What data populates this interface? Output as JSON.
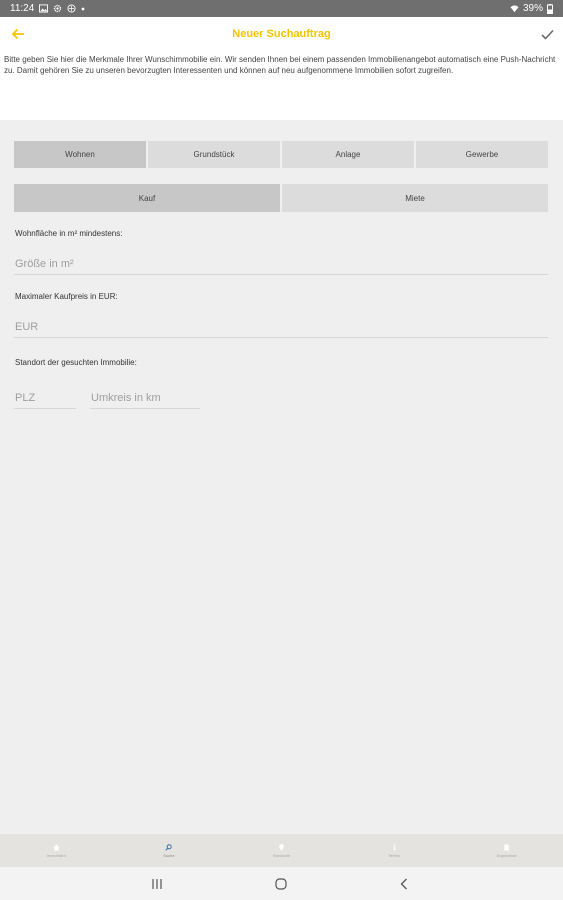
{
  "status_bar": {
    "time": "11:24",
    "battery": "39%",
    "icons": [
      "image-icon",
      "settings-icon",
      "vpn-icon",
      "dot-icon",
      "wifi-icon",
      "battery-icon"
    ]
  },
  "app_bar": {
    "title": "Neuer Suchauftrag",
    "back_icon": "arrow-left-icon",
    "confirm_icon": "check-icon",
    "accent_color": "#f5c400"
  },
  "intro_text": "Bitte geben Sie hier die Merkmale Ihrer Wunschimmobilie ein. Wir senden Ihnen bei einem passenden Immobilienangebot automatisch eine Push-Nachricht zu. Damit gehören Sie zu unseren bevorzugten Interessenten und können auf neu aufgenommene Immobilien sofort zugreifen.",
  "property_types": {
    "selected": "Wohnen",
    "options": [
      "Wohnen",
      "Grundstück",
      "Anlage",
      "Gewerbe"
    ]
  },
  "transaction_types": {
    "selected": "Kauf",
    "options": [
      "Kauf",
      "Miete"
    ]
  },
  "form": {
    "area": {
      "label": "Wohnfläche in m² mindestens:",
      "placeholder": "Größe in m²",
      "value": ""
    },
    "price": {
      "label": "Maximaler Kaufpreis in EUR:",
      "placeholder": "EUR",
      "value": ""
    },
    "location": {
      "label": "Standort der gesuchten Immobilie:",
      "zip_placeholder": "PLZ",
      "radius_placeholder": "Umkreis in km"
    }
  },
  "bottom_nav": {
    "items": [
      {
        "label": "Immobilien",
        "icon": "home-icon"
      },
      {
        "label": "Suche",
        "icon": "search-icon"
      },
      {
        "label": "Standorte",
        "icon": "location-pin-icon"
      },
      {
        "label": "Termin",
        "icon": "info-icon"
      },
      {
        "label": "Ergebnisse",
        "icon": "euro-icon"
      }
    ],
    "active": "Suche"
  },
  "system_nav": {
    "icons": [
      "recent-apps-icon",
      "home-button-icon",
      "back-button-icon"
    ]
  }
}
